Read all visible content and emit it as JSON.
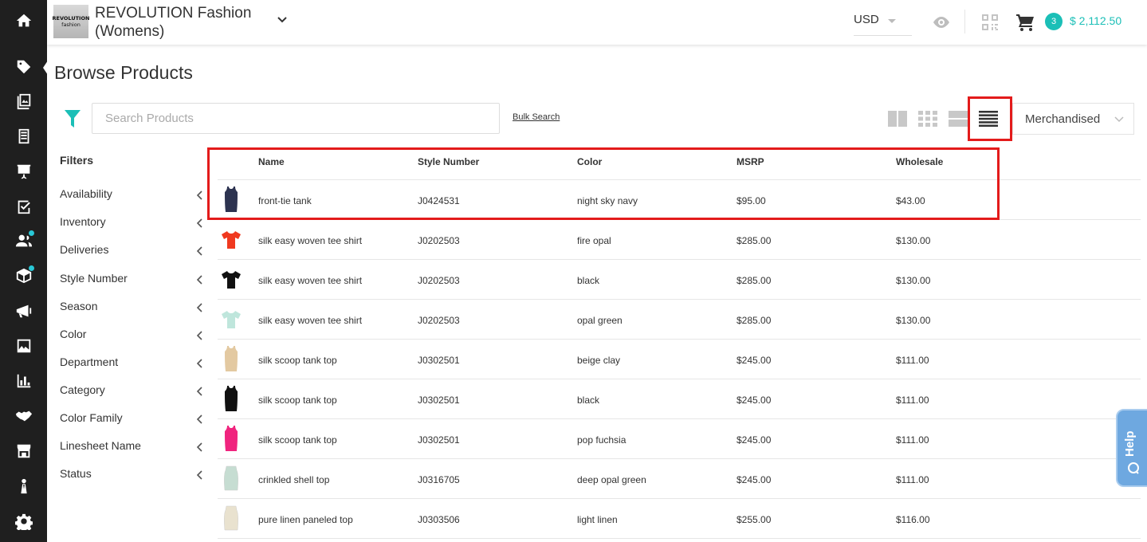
{
  "header": {
    "logo_line1": "REVOLUTION",
    "logo_line2": "fashion",
    "store_line1": "REVOLUTION Fashion",
    "store_line2": "(Womens)",
    "currency": "USD",
    "cart_count": "3",
    "cart_total": "$ 2,112.50"
  },
  "page": {
    "title": "Browse Products"
  },
  "toolbar": {
    "search_placeholder": "Search Products",
    "bulk_search": "Bulk Search",
    "sort_selected": "Merchandised"
  },
  "filters": {
    "title": "Filters",
    "items": [
      "Availability",
      "Inventory",
      "Deliveries",
      "Style Number",
      "Season",
      "Color",
      "Department",
      "Category",
      "Color Family",
      "Linesheet Name",
      "Status"
    ]
  },
  "table": {
    "columns": {
      "name": "Name",
      "style": "Style Number",
      "color": "Color",
      "msrp": "MSRP",
      "wholesale": "Wholesale"
    },
    "rows": [
      {
        "name": "front-tie tank",
        "style": "J0424531",
        "color": "night sky navy",
        "msrp": "$95.00",
        "wholesale": "$43.00",
        "swatch": "#2d3350"
      },
      {
        "name": "silk easy woven tee shirt",
        "style": "J0202503",
        "color": "fire opal",
        "msrp": "$285.00",
        "wholesale": "$130.00",
        "swatch": "#f0391f"
      },
      {
        "name": "silk easy woven tee shirt",
        "style": "J0202503",
        "color": "black",
        "msrp": "$285.00",
        "wholesale": "$130.00",
        "swatch": "#111111"
      },
      {
        "name": "silk easy woven tee shirt",
        "style": "J0202503",
        "color": "opal green",
        "msrp": "$285.00",
        "wholesale": "$130.00",
        "swatch": "#bfe6dc"
      },
      {
        "name": "silk scoop tank top",
        "style": "J0302501",
        "color": "beige clay",
        "msrp": "$245.00",
        "wholesale": "$111.00",
        "swatch": "#e3c9a1"
      },
      {
        "name": "silk scoop tank top",
        "style": "J0302501",
        "color": "black",
        "msrp": "$245.00",
        "wholesale": "$111.00",
        "swatch": "#111111"
      },
      {
        "name": "silk scoop tank top",
        "style": "J0302501",
        "color": "pop fuchsia",
        "msrp": "$245.00",
        "wholesale": "$111.00",
        "swatch": "#f0247e"
      },
      {
        "name": "crinkled shell top",
        "style": "J0316705",
        "color": "deep opal green",
        "msrp": "$245.00",
        "wholesale": "$111.00",
        "swatch": "#c6ddd2"
      },
      {
        "name": "pure linen paneled top",
        "style": "J0303506",
        "color": "light linen",
        "msrp": "$255.00",
        "wholesale": "$116.00",
        "swatch": "#e9e2cf"
      }
    ]
  },
  "help": {
    "label": "Help"
  },
  "colors": {
    "accent": "#1bbfb7",
    "highlight": "#e31b1b",
    "sidebar": "#1f1f1f",
    "help": "#6ea8e0"
  }
}
